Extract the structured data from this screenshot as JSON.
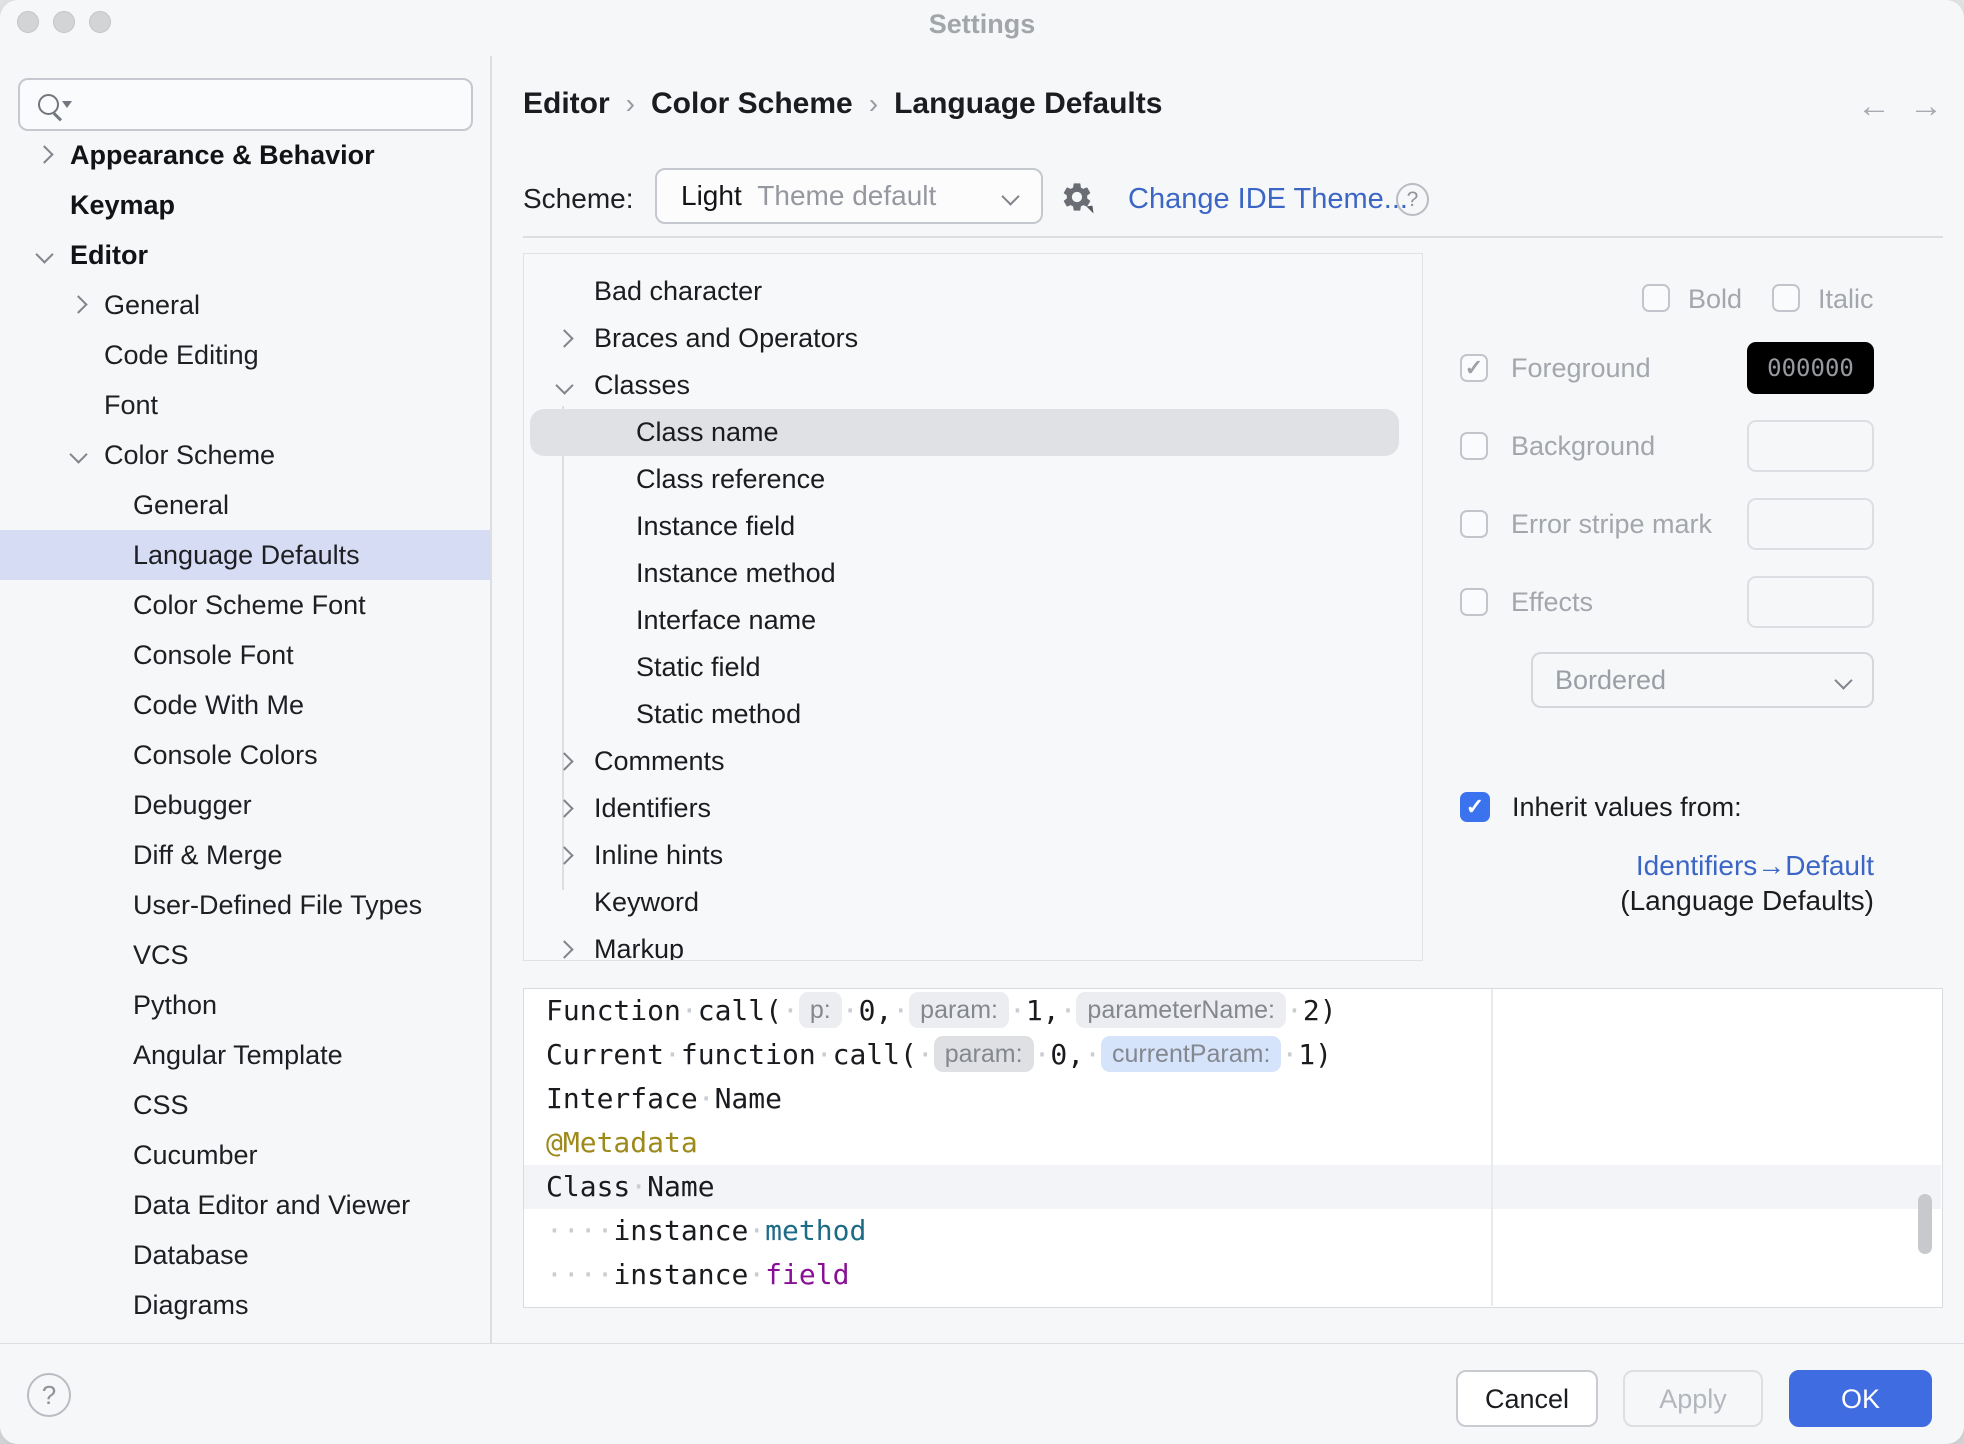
{
  "window": {
    "title": "Settings"
  },
  "sidebar": {
    "search": {
      "value": "",
      "placeholder": ""
    },
    "items": [
      {
        "label": "Appearance & Behavior",
        "level": 1,
        "bold": true,
        "chevron": "right"
      },
      {
        "label": "Keymap",
        "level": 1,
        "bold": true
      },
      {
        "label": "Editor",
        "level": 1,
        "bold": true,
        "chevron": "down"
      },
      {
        "label": "General",
        "level": 2,
        "chevron": "right"
      },
      {
        "label": "Code Editing",
        "level": 2
      },
      {
        "label": "Font",
        "level": 2
      },
      {
        "label": "Color Scheme",
        "level": 2,
        "chevron": "down"
      },
      {
        "label": "General",
        "level": 3
      },
      {
        "label": "Language Defaults",
        "level": 3,
        "selected": true
      },
      {
        "label": "Color Scheme Font",
        "level": 3
      },
      {
        "label": "Console Font",
        "level": 3
      },
      {
        "label": "Code With Me",
        "level": 3
      },
      {
        "label": "Console Colors",
        "level": 3
      },
      {
        "label": "Debugger",
        "level": 3
      },
      {
        "label": "Diff & Merge",
        "level": 3
      },
      {
        "label": "User-Defined File Types",
        "level": 3
      },
      {
        "label": "VCS",
        "level": 3
      },
      {
        "label": "Python",
        "level": 3
      },
      {
        "label": "Angular Template",
        "level": 3
      },
      {
        "label": "CSS",
        "level": 3
      },
      {
        "label": "Cucumber",
        "level": 3
      },
      {
        "label": "Data Editor and Viewer",
        "level": 3
      },
      {
        "label": "Database",
        "level": 3
      },
      {
        "label": "Diagrams",
        "level": 3
      }
    ]
  },
  "breadcrumb": {
    "items": [
      "Editor",
      "Color Scheme",
      "Language Defaults"
    ],
    "separator": "›"
  },
  "header": {
    "back_arrow": "←",
    "forward_arrow": "→"
  },
  "scheme": {
    "label": "Scheme:",
    "value_primary": "Light",
    "value_secondary": "Theme default",
    "change_link": "Change IDE Theme...",
    "help": "?"
  },
  "tree": {
    "items": [
      {
        "label": "Bad character",
        "level": 1
      },
      {
        "label": "Braces and Operators",
        "level": 1,
        "chevron": "right"
      },
      {
        "label": "Classes",
        "level": 1,
        "chevron": "down"
      },
      {
        "label": "Class name",
        "level": 2,
        "selected": true
      },
      {
        "label": "Class reference",
        "level": 2
      },
      {
        "label": "Instance field",
        "level": 2
      },
      {
        "label": "Instance method",
        "level": 2
      },
      {
        "label": "Interface name",
        "level": 2
      },
      {
        "label": "Static field",
        "level": 2
      },
      {
        "label": "Static method",
        "level": 2
      },
      {
        "label": "Comments",
        "level": 1,
        "chevron": "right"
      },
      {
        "label": "Identifiers",
        "level": 1,
        "chevron": "right"
      },
      {
        "label": "Inline hints",
        "level": 1,
        "chevron": "right"
      },
      {
        "label": "Keyword",
        "level": 1
      },
      {
        "label": "Markup",
        "level": 1,
        "chevron": "right"
      }
    ]
  },
  "attributes": {
    "bold_label": "Bold",
    "italic_label": "Italic",
    "bold_checked": false,
    "italic_checked": false,
    "rows": [
      {
        "label": "Foreground",
        "checked": true,
        "value": "000000",
        "swatch": "#000000"
      },
      {
        "label": "Background",
        "checked": false,
        "value": ""
      },
      {
        "label": "Error stripe mark",
        "checked": false,
        "value": ""
      },
      {
        "label": "Effects",
        "checked": false,
        "value": ""
      }
    ],
    "effects_dropdown": "Bordered",
    "inherit_label": "Inherit values from:",
    "inherit_checked": true,
    "inherit_link": "Identifiers→Default",
    "inherit_sub": "(Language Defaults)"
  },
  "preview": {
    "lines": [
      {
        "segments": [
          [
            "Function call( ",
            "plain"
          ],
          [
            "p:",
            "chip"
          ],
          [
            " 0, ",
            "plain"
          ],
          [
            "param:",
            "chip"
          ],
          [
            " 1, ",
            "plain"
          ],
          [
            "parameterName:",
            "chip"
          ],
          [
            " 2)",
            "plain"
          ]
        ]
      },
      {
        "segments": [
          [
            "Current function call( ",
            "plain"
          ],
          [
            "param:",
            "chip_current"
          ],
          [
            " 0, ",
            "plain"
          ],
          [
            "currentParam:",
            "chip_active"
          ],
          [
            " 1)",
            "plain"
          ]
        ]
      },
      {
        "segments": [
          [
            "Interface Name",
            "plain"
          ]
        ]
      },
      {
        "segments": [
          [
            "@Metadata",
            "metadata"
          ]
        ]
      },
      {
        "segments": [
          [
            "Class Name",
            "plain"
          ]
        ],
        "current_line": true
      },
      {
        "segments": [
          [
            "    instance ",
            "plain"
          ],
          [
            "method",
            "method"
          ]
        ]
      },
      {
        "segments": [
          [
            "    instance ",
            "plain"
          ],
          [
            "field",
            "field"
          ]
        ]
      }
    ]
  },
  "footer": {
    "help": "?",
    "cancel": "Cancel",
    "apply": "Apply",
    "ok": "OK"
  },
  "colors": {
    "accent_blue": "#3b72ee",
    "ok_button": "#3f6ce0",
    "link_blue": "#3c66c6",
    "sidebar_selection": "#d6dcf4",
    "tree_selection": "#e0e1e4",
    "foreground_swatch": "#000000",
    "swatch_text": "#96999f",
    "syntax_metadata": "#9e8a1b",
    "syntax_method": "#1d6b87",
    "syntax_field": "#871094",
    "current_line": "#f3f4f8"
  }
}
